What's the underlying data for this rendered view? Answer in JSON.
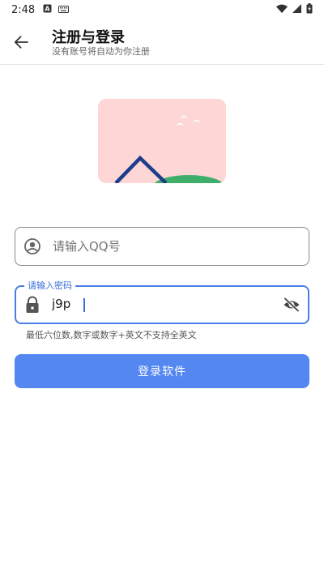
{
  "status_bar": {
    "time": "2:48",
    "left_icons": [
      "notification-a-icon",
      "keyboard-icon"
    ],
    "right_icons": [
      "wifi-icon",
      "signal-icon",
      "battery-icon"
    ]
  },
  "app_bar": {
    "back_icon": "arrow-back-icon",
    "title": "注册与登录",
    "subtitle": "没有账号将自动为你注册"
  },
  "illustration": {
    "icon": "image-placeholder-icon",
    "colors": {
      "background": "#fdd6d5",
      "mountain": "#1e3c8c",
      "hill": "#3fae6a",
      "birds": "#ffffff"
    }
  },
  "qq_field": {
    "icon": "account-circle-icon",
    "placeholder": "请输入QQ号",
    "value": ""
  },
  "password_field": {
    "label": "请输入密码",
    "icon": "lock-icon",
    "value": "j9p",
    "trailing_icon": "visibility-off-icon"
  },
  "hint": "最低六位数,数字或数字+英文不支持全英文",
  "login_button": {
    "label": "登录软件"
  },
  "colors": {
    "accent": "#4a7fe7",
    "button": "#5487f0"
  }
}
